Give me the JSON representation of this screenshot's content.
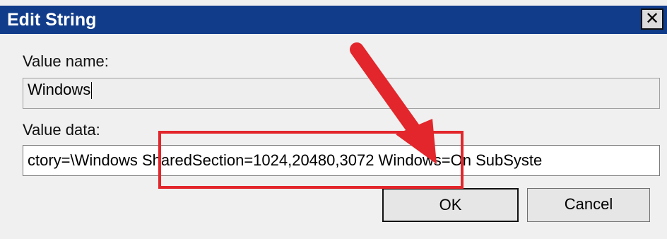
{
  "dialog": {
    "title": "Edit String",
    "close_glyph": "✕",
    "value_name_label": "Value name:",
    "value_name": "Windows",
    "value_data_label": "Value data:",
    "value_data": "ctory=\\Windows SharedSection=1024,20480,3072 Windows=On SubSyste",
    "ok_label": "OK",
    "cancel_label": "Cancel"
  },
  "annotation": {
    "highlight_color": "#e2262b",
    "arrow_color": "#e2262b"
  }
}
